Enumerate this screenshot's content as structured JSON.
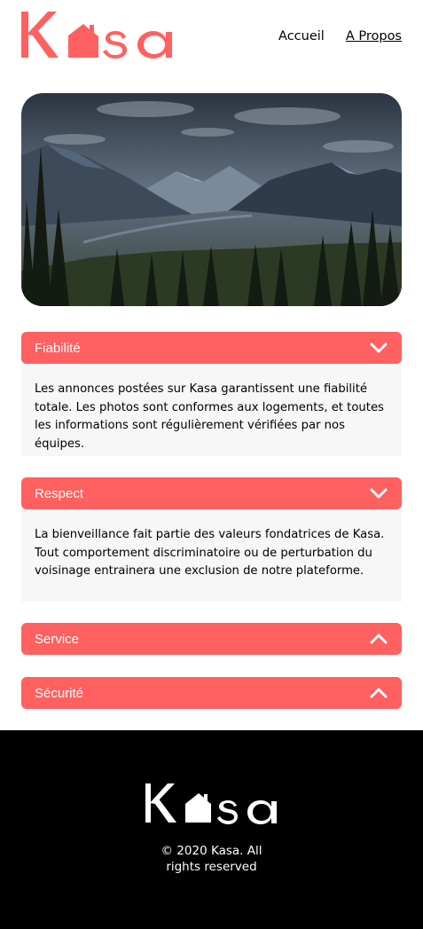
{
  "header": {
    "logo_text": "Kasa",
    "nav": [
      {
        "label": "Accueil",
        "active": false
      },
      {
        "label": "A Propos",
        "active": true
      }
    ]
  },
  "banner": {
    "alt": "mountain landscape"
  },
  "accordions": [
    {
      "title": "Fiabilité",
      "open": true,
      "chevron": "chevron-down-icon",
      "text": "Les annonces postées sur Kasa garantissent une fiabilité totale. Les photos sont conformes aux logements, et toutes les informations sont régulièrement vérifiées par nos équipes."
    },
    {
      "title": "Respect",
      "open": true,
      "chevron": "chevron-down-icon",
      "text": "La bienveillance fait partie des valeurs fondatrices de Kasa. Tout comportement discriminatoire ou de perturbation du voisinage entrainera une exclusion de notre plateforme."
    },
    {
      "title": "Service",
      "open": false,
      "chevron": "chevron-up-icon"
    },
    {
      "title": "Sécurité",
      "open": false,
      "chevron": "chevron-up-icon"
    }
  ],
  "footer": {
    "logo_text": "Kasa",
    "copyright_line1": "© 2020 Kasa. All",
    "copyright_line2": "rights reserved"
  },
  "colors": {
    "accent": "#FF6060",
    "footer_bg": "#000000",
    "panel_bg": "#F7F7F7"
  }
}
